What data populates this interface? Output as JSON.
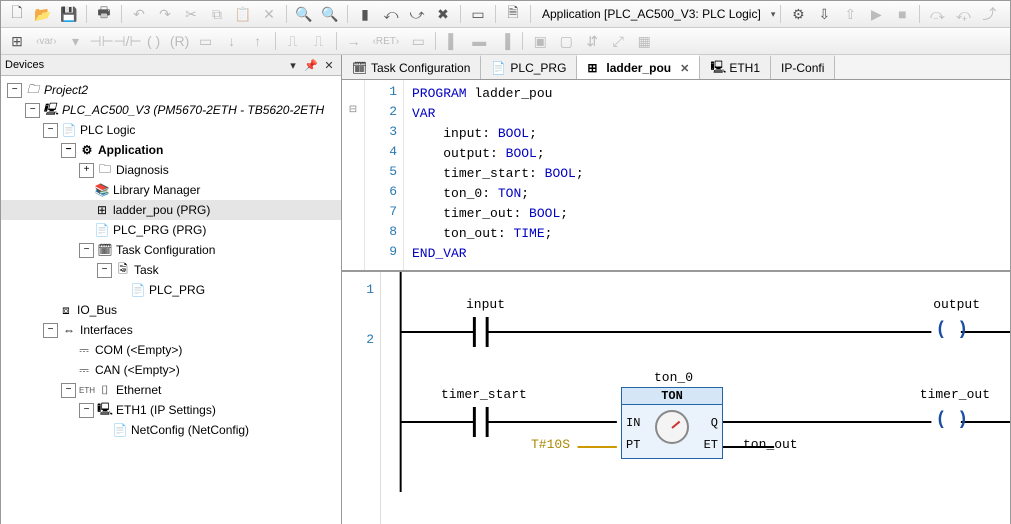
{
  "toolbar1": {
    "app_label": "Application [PLC_AC500_V3: PLC Logic]",
    "icons": [
      {
        "name": "new-icon",
        "glyph": "🗋"
      },
      {
        "name": "open-icon",
        "glyph": "📂"
      },
      {
        "name": "save-icon",
        "glyph": "💾"
      },
      {
        "name": "sep"
      },
      {
        "name": "print-icon",
        "glyph": "🖶"
      },
      {
        "name": "sep"
      },
      {
        "name": "undo-icon",
        "glyph": "↶",
        "dim": true
      },
      {
        "name": "redo-icon",
        "glyph": "↷",
        "dim": true
      },
      {
        "name": "cut-icon",
        "glyph": "✂",
        "dim": true
      },
      {
        "name": "copy-icon",
        "glyph": "⧉",
        "dim": true
      },
      {
        "name": "paste-icon",
        "glyph": "📋",
        "dim": true
      },
      {
        "name": "delete-icon",
        "glyph": "✕",
        "dim": true
      },
      {
        "name": "sep"
      },
      {
        "name": "find-icon",
        "glyph": "🔍"
      },
      {
        "name": "find-replace-icon",
        "glyph": "🔍"
      },
      {
        "name": "sep"
      },
      {
        "name": "bookmark-icon",
        "glyph": "▮"
      },
      {
        "name": "prev-bm-icon",
        "glyph": "⤺"
      },
      {
        "name": "next-bm-icon",
        "glyph": "⤻"
      },
      {
        "name": "clear-bm-icon",
        "glyph": "✖"
      },
      {
        "name": "sep"
      },
      {
        "name": "box-icon",
        "glyph": "▭"
      },
      {
        "name": "sep"
      },
      {
        "name": "doc-icon",
        "glyph": "🗎"
      },
      {
        "name": "sep"
      }
    ],
    "right_icons": [
      {
        "name": "build-icon",
        "glyph": "⚙"
      },
      {
        "name": "login-icon",
        "glyph": "⇩"
      },
      {
        "name": "logout-icon",
        "glyph": "⇧",
        "dim": true
      },
      {
        "name": "start-icon",
        "glyph": "▶",
        "dim": true
      },
      {
        "name": "stop-icon",
        "glyph": "■",
        "dim": true
      },
      {
        "name": "sep"
      },
      {
        "name": "step-over-icon",
        "glyph": "⤼",
        "dim": true
      },
      {
        "name": "step-into-icon",
        "glyph": "⤽",
        "dim": true
      },
      {
        "name": "step-out-icon",
        "glyph": "⤴",
        "dim": true
      },
      {
        "name": "run-cursor-icon",
        "glyph": "⇥",
        "dim": true
      }
    ]
  },
  "toolbar2": {
    "icons": [
      {
        "name": "ld-network-icon",
        "glyph": "⊞",
        "active": true
      },
      {
        "name": "var-icon",
        "glyph": "‹var›",
        "dim": true,
        "wide": true
      },
      {
        "name": "var-dd-icon",
        "glyph": "▾",
        "dim": true
      },
      {
        "name": "ld-contact-no-icon",
        "glyph": "⊣⊢",
        "dim": true
      },
      {
        "name": "ld-contact-nc-icon",
        "glyph": "⊣/⊢",
        "dim": true
      },
      {
        "name": "ld-coil-icon",
        "glyph": "( )",
        "dim": true
      },
      {
        "name": "ld-coil-r-icon",
        "glyph": "(R)",
        "dim": true
      },
      {
        "name": "ld-fb-icon",
        "glyph": "▭",
        "dim": true
      },
      {
        "name": "ld-down-icon",
        "glyph": "↓",
        "dim": true
      },
      {
        "name": "ld-up-icon",
        "glyph": "↑",
        "dim": true
      },
      {
        "name": "sep"
      },
      {
        "name": "ld-branch-icon",
        "glyph": "⎍",
        "dim": true
      },
      {
        "name": "ld-branch2-icon",
        "glyph": "⎍",
        "dim": true
      },
      {
        "name": "sep"
      },
      {
        "name": "jump-icon",
        "glyph": "→",
        "dim": true
      },
      {
        "name": "ret-icon",
        "glyph": "‹RET›",
        "dim": true,
        "wide": true
      },
      {
        "name": "ld-extra-icon",
        "glyph": "▭",
        "dim": true
      },
      {
        "name": "sep"
      },
      {
        "name": "align-l-icon",
        "glyph": "▌",
        "dim": true
      },
      {
        "name": "align-c-icon",
        "glyph": "▬",
        "dim": true
      },
      {
        "name": "align-r-icon",
        "glyph": "▐",
        "dim": true
      },
      {
        "name": "sep"
      },
      {
        "name": "collapse-icon",
        "glyph": "▣",
        "dim": true
      },
      {
        "name": "expand-icon",
        "glyph": "▢",
        "dim": true
      },
      {
        "name": "arrange-icon",
        "glyph": "⇵",
        "dim": true
      },
      {
        "name": "zoom-fit-icon",
        "glyph": "⤢",
        "dim": true
      },
      {
        "name": "grid-icon",
        "glyph": "▦",
        "dim": true
      }
    ]
  },
  "devices_panel": {
    "title": "Devices",
    "tree": [
      {
        "d": 0,
        "exp": "-",
        "ico": "🗀",
        "label": "Project2",
        "italic": true
      },
      {
        "d": 1,
        "exp": "-",
        "ico": "🖳",
        "label": "PLC_AC500_V3 (PM5670-2ETH - TB5620-2ETH",
        "italic": true
      },
      {
        "d": 2,
        "exp": "-",
        "ico": "📄",
        "label": "PLC Logic"
      },
      {
        "d": 3,
        "exp": "-",
        "ico": "⚙",
        "label": "Application",
        "bold": true
      },
      {
        "d": 4,
        "exp": "+",
        "ico": "🗀",
        "label": "Diagnosis"
      },
      {
        "d": 4,
        "exp": "",
        "ico": "📚",
        "label": "Library Manager"
      },
      {
        "d": 4,
        "exp": "",
        "ico": "⊞",
        "label": "ladder_pou (PRG)",
        "sel": true
      },
      {
        "d": 4,
        "exp": "",
        "ico": "📄",
        "label": "PLC_PRG (PRG)"
      },
      {
        "d": 4,
        "exp": "-",
        "ico": "🗓",
        "label": "Task Configuration"
      },
      {
        "d": 5,
        "exp": "-",
        "ico": "🗟",
        "label": "Task"
      },
      {
        "d": 6,
        "exp": "",
        "ico": "📄",
        "label": "PLC_PRG"
      },
      {
        "d": 2,
        "exp": "",
        "ico": "⧈",
        "label": "IO_Bus"
      },
      {
        "d": 2,
        "exp": "-",
        "ico": "⇔",
        "label": "Interfaces"
      },
      {
        "d": 3,
        "exp": "",
        "ico": "⎓",
        "label": "COM (<Empty>)"
      },
      {
        "d": 3,
        "exp": "",
        "ico": "⎓",
        "label": "CAN (<Empty>)"
      },
      {
        "d": 3,
        "exp": "-",
        "ico": "⌷",
        "label": "Ethernet",
        "pre": "ETH"
      },
      {
        "d": 4,
        "exp": "-",
        "ico": "🖳",
        "label": "ETH1 (IP Settings)"
      },
      {
        "d": 5,
        "exp": "",
        "ico": "📄",
        "label": "NetConfig (NetConfig)"
      }
    ]
  },
  "editor": {
    "tabs": [
      {
        "name": "tab-task-config",
        "ico": "🗓",
        "label": "Task Configuration"
      },
      {
        "name": "tab-plc-prg",
        "ico": "📄",
        "label": "PLC_PRG"
      },
      {
        "name": "tab-ladder-pou",
        "ico": "⊞",
        "label": "ladder_pou",
        "active": true,
        "close": true
      },
      {
        "name": "tab-eth1",
        "ico": "🖳",
        "label": "ETH1"
      },
      {
        "name": "tab-ip-config",
        "ico": "",
        "label": "IP-Confi"
      }
    ],
    "code": {
      "lines": [
        {
          "n": 1,
          "html": "<span class='kw'>PROGRAM</span> <span class='id'>ladder_pou</span>"
        },
        {
          "n": 2,
          "html": "<span class='kw'>VAR</span>"
        },
        {
          "n": 3,
          "html": "    <span class='id'>input</span>: <span class='ty'>BOOL</span>;"
        },
        {
          "n": 4,
          "html": "    <span class='id'>output</span>: <span class='ty'>BOOL</span>;"
        },
        {
          "n": 5,
          "html": "    <span class='id'>timer_start</span>: <span class='ty'>BOOL</span>;"
        },
        {
          "n": 6,
          "html": "    <span class='id'>ton_0</span>: <span class='ty'>TON</span>;"
        },
        {
          "n": 7,
          "html": "    <span class='id'>timer_out</span>: <span class='ty'>BOOL</span>;"
        },
        {
          "n": 8,
          "html": "    <span class='id'>ton_out</span>: <span class='ty'>TIME</span>;"
        },
        {
          "n": 9,
          "html": "<span class='kw'>END_VAR</span>"
        }
      ]
    },
    "ladder": {
      "rung1": {
        "contact": "input",
        "coil": "output"
      },
      "rung2": {
        "contact": "timer_start",
        "pt": "T#10S",
        "inst": "ton_0",
        "type": "TON",
        "q": "timer_out",
        "et": "ton_out"
      }
    }
  }
}
